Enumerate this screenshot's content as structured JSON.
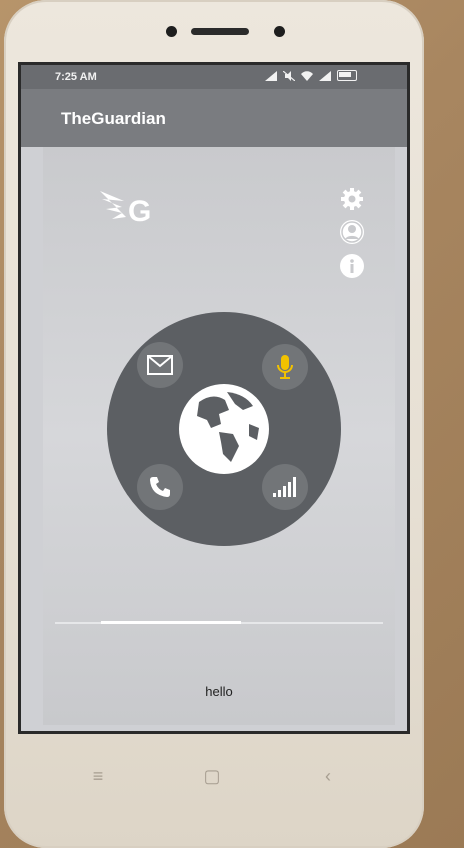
{
  "status": {
    "time": "7:25 AM"
  },
  "app": {
    "title": "TheGuardian"
  },
  "logo": {
    "letter": "G"
  },
  "main": {
    "message": "hello"
  },
  "icons": {
    "settings": "gear-icon",
    "profile": "profile-icon",
    "info": "info-icon",
    "mail": "mail-icon",
    "mic": "microphone-icon",
    "call": "phone-icon",
    "signal": "signal-icon",
    "globe": "globe-icon"
  },
  "colors": {
    "mic_accent": "#f2c200",
    "dial": "#5c5f63"
  },
  "nav": {
    "menu": "≡",
    "home": "▢",
    "back": "‹"
  }
}
